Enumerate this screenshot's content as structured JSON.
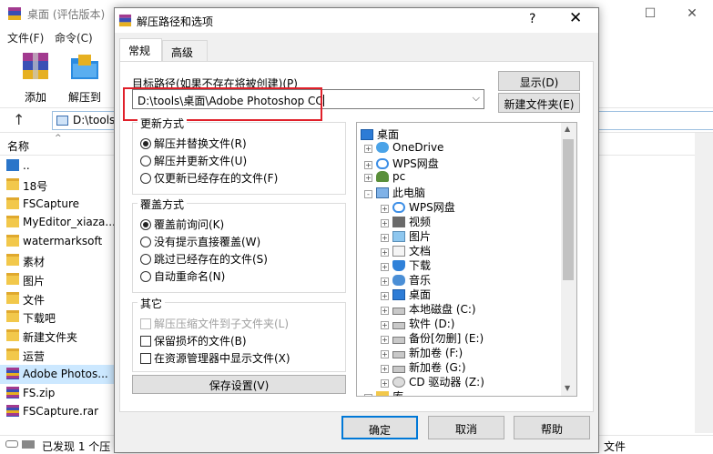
{
  "main_window": {
    "title": "桌面 (评估版本)",
    "menu": [
      "文件(F)",
      "命令(C)"
    ],
    "toolbar": [
      {
        "label": "添加",
        "icon": "rar-archive-icon"
      },
      {
        "label": "解压到",
        "icon": "extract-folder-icon"
      }
    ],
    "address": "D:\\tools",
    "column_name": "名称",
    "files": [
      {
        "name": "..",
        "icon": "up-folder-icon"
      },
      {
        "name": "18号",
        "icon": "folder-icon"
      },
      {
        "name": "FSCapture",
        "icon": "folder-icon"
      },
      {
        "name": "MyEditor_xiaza...",
        "icon": "folder-icon"
      },
      {
        "name": "watermarksoft",
        "icon": "folder-icon"
      },
      {
        "name": "素材",
        "icon": "folder-icon"
      },
      {
        "name": "图片",
        "icon": "folder-icon"
      },
      {
        "name": "文件",
        "icon": "folder-icon"
      },
      {
        "name": "下载吧",
        "icon": "folder-icon"
      },
      {
        "name": "新建文件夹",
        "icon": "folder-icon"
      },
      {
        "name": "运营",
        "icon": "folder-icon"
      },
      {
        "name": "Adobe Photos...",
        "icon": "rar-file-icon",
        "selected": true
      },
      {
        "name": "FS.zip",
        "icon": "rar-file-icon"
      },
      {
        "name": "FSCapture.rar",
        "icon": "rar-file-icon"
      }
    ],
    "status_left": "已发现 1 个压",
    "status_right": "文件"
  },
  "dialog": {
    "title": "解压路径和选项",
    "help": "?",
    "close": "✕",
    "tabs": [
      "常规",
      "高级"
    ],
    "target_label": "目标路径(如果不存在将被创建)(P)",
    "target_value": "D:\\tools\\桌面\\Adobe Photoshop CC",
    "show_button": "显示(D)",
    "new_folder_button": "新建文件夹(E)",
    "update_group": {
      "title": "更新方式",
      "options": [
        "解压并替换文件(R)",
        "解压并更新文件(U)",
        "仅更新已经存在的文件(F)"
      ],
      "selected": 0
    },
    "overwrite_group": {
      "title": "覆盖方式",
      "options": [
        "覆盖前询问(K)",
        "没有提示直接覆盖(W)",
        "跳过已经存在的文件(S)",
        "自动重命名(N)"
      ],
      "selected": 0
    },
    "other_group": {
      "title": "其它",
      "options": [
        {
          "label": "解压压缩文件到子文件夹(L)",
          "disabled": true
        },
        {
          "label": "保留损坏的文件(B)",
          "disabled": false
        },
        {
          "label": "在资源管理器中显示文件(X)",
          "disabled": false
        }
      ]
    },
    "save_button": "保存设置(V)",
    "tree": [
      {
        "label": "桌面",
        "icon": "desktop-icon",
        "level": 0,
        "expander": ""
      },
      {
        "label": "OneDrive",
        "icon": "onedrive-cloud-icon",
        "level": 1,
        "expander": "+"
      },
      {
        "label": "WPS网盘",
        "icon": "wps-cloud-icon",
        "level": 1,
        "expander": "+"
      },
      {
        "label": "pc",
        "icon": "user-icon",
        "level": 1,
        "expander": "+"
      },
      {
        "label": "此电脑",
        "icon": "computer-icon",
        "level": 1,
        "expander": "-"
      },
      {
        "label": "WPS网盘",
        "icon": "wps-cloud-icon",
        "level": 2,
        "expander": "+"
      },
      {
        "label": "视频",
        "icon": "video-folder-icon",
        "level": 2,
        "expander": "+"
      },
      {
        "label": "图片",
        "icon": "pictures-folder-icon",
        "level": 2,
        "expander": "+"
      },
      {
        "label": "文档",
        "icon": "documents-folder-icon",
        "level": 2,
        "expander": "+"
      },
      {
        "label": "下载",
        "icon": "downloads-folder-icon",
        "level": 2,
        "expander": "+"
      },
      {
        "label": "音乐",
        "icon": "music-folder-icon",
        "level": 2,
        "expander": "+"
      },
      {
        "label": "桌面",
        "icon": "desktop-icon",
        "level": 2,
        "expander": "+"
      },
      {
        "label": "本地磁盘 (C:)",
        "icon": "drive-icon",
        "level": 2,
        "expander": "+"
      },
      {
        "label": "软件 (D:)",
        "icon": "drive-icon",
        "level": 2,
        "expander": "+"
      },
      {
        "label": "备份[勿删] (E:)",
        "icon": "drive-icon",
        "level": 2,
        "expander": "+"
      },
      {
        "label": "新加卷 (F:)",
        "icon": "drive-icon",
        "level": 2,
        "expander": "+"
      },
      {
        "label": "新加卷 (G:)",
        "icon": "drive-icon",
        "level": 2,
        "expander": "+"
      },
      {
        "label": "CD 驱动器 (Z:)",
        "icon": "cd-drive-icon",
        "level": 2,
        "expander": "+"
      },
      {
        "label": "库",
        "icon": "library-icon",
        "level": 1,
        "expander": "+"
      }
    ],
    "ok_button": "确定",
    "cancel_button": "取消",
    "help_button": "帮助"
  },
  "colors": {
    "accent": "#0078d7",
    "highlight_box": "#e0202a",
    "selection": "#cce8ff"
  }
}
